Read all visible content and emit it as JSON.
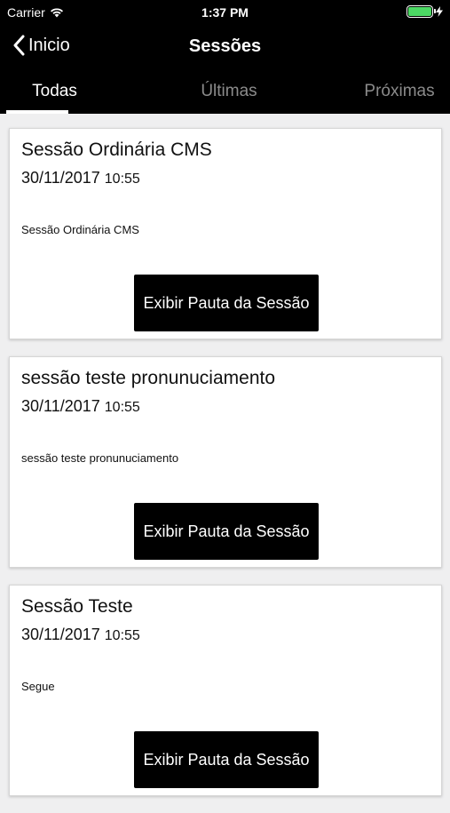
{
  "status": {
    "carrier": "Carrier",
    "time": "1:37 PM"
  },
  "nav": {
    "back_label": "Inicio",
    "title": "Sessões"
  },
  "tabs": [
    {
      "label": "Todas",
      "active": true
    },
    {
      "label": "Últimas",
      "active": false
    },
    {
      "label": "Próximas",
      "active": false
    }
  ],
  "sessions": [
    {
      "title": "Sessão Ordinária CMS",
      "date": "30/11/2017",
      "time": "10:55",
      "description": "Sessão Ordinária CMS",
      "button": "Exibir Pauta da Sessão"
    },
    {
      "title": "sessão teste pronunuciamento",
      "date": "30/11/2017",
      "time": "10:55",
      "description": "sessão teste pronunuciamento",
      "button": "Exibir Pauta da Sessão"
    },
    {
      "title": "Sessão Teste",
      "date": "30/11/2017",
      "time": "10:55",
      "description": "Segue",
      "button": "Exibir Pauta da Sessão"
    }
  ],
  "colors": {
    "header_bg": "#000000",
    "battery": "#4cd964",
    "page_bg": "#efeff0"
  }
}
